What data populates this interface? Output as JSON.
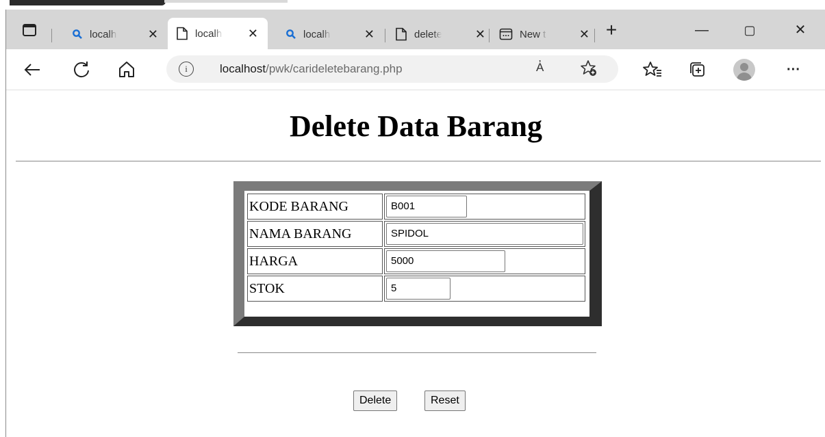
{
  "tabs": [
    {
      "label": "localh",
      "icon": "search-icon"
    },
    {
      "label": "localh",
      "icon": "page-icon"
    },
    {
      "label": "localh",
      "icon": "search-icon"
    },
    {
      "label": "delete",
      "icon": "page-icon"
    },
    {
      "label": "New t",
      "icon": "newtab-icon"
    }
  ],
  "tab_close": "✕",
  "new_tab_button": "+",
  "window_controls": {
    "minimize": "—",
    "maximize": "▢",
    "close": "✕"
  },
  "address": {
    "host": "localhost",
    "path": "/pwk/carideletebarang.php",
    "read_aloud": "A҆",
    "info": "i"
  },
  "toolbar": {
    "more": "···"
  },
  "page": {
    "title": "Delete Data Barang",
    "rows": [
      {
        "label": "KODE BARANG",
        "value": "B001"
      },
      {
        "label": "NAMA BARANG",
        "value": "SPIDOL"
      },
      {
        "label": "HARGA",
        "value": "5000"
      },
      {
        "label": "STOK",
        "value": "5"
      }
    ],
    "delete_button": "Delete",
    "reset_button": "Reset"
  }
}
